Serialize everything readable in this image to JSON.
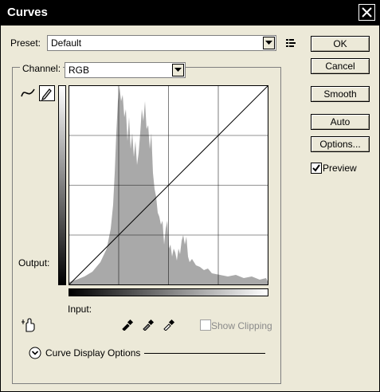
{
  "window": {
    "title": "Curves"
  },
  "preset": {
    "label": "Preset:",
    "value": "Default"
  },
  "channel": {
    "label": "Channel:",
    "value": "RGB"
  },
  "buttons": {
    "ok": "OK",
    "cancel": "Cancel",
    "smooth": "Smooth",
    "auto": "Auto",
    "options": "Options..."
  },
  "preview": {
    "label": "Preview",
    "checked": true
  },
  "graph": {
    "output_label": "Output:",
    "input_label": "Input:",
    "show_clipping_label": "Show Clipping",
    "show_clipping_checked": false
  },
  "display_options": {
    "label": "Curve Display Options"
  },
  "icons": [
    "close-icon",
    "curve-tool-icon",
    "pencil-tool-icon",
    "preset-menu-icon",
    "hand-adjust-icon",
    "black-eyedropper-icon",
    "gray-eyedropper-icon",
    "white-eyedropper-icon",
    "expand-chevron-icon"
  ]
}
